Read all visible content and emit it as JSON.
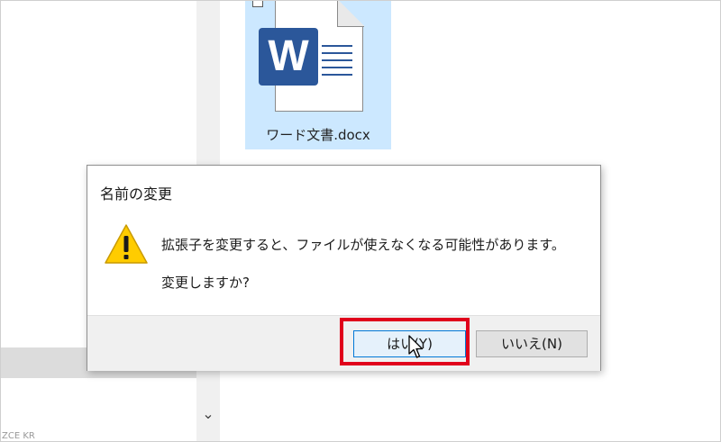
{
  "explorer": {
    "file_name": "ワード文書.docx",
    "word_badge_letter": "W",
    "nav_bottom_text": "ZCE KR",
    "scroll_down_glyph": "⌄"
  },
  "dialog": {
    "title": "名前の変更",
    "message": "拡張子を変更すると、ファイルが使えなくなる可能性があります。",
    "question": "変更しますか?",
    "yes_label": "はい(Y)",
    "no_label": "いいえ(N)"
  },
  "colors": {
    "selection": "#cce8ff",
    "word_blue": "#2b579a",
    "highlight_red": "#e0001b",
    "warning_yellow": "#ffcc00"
  }
}
